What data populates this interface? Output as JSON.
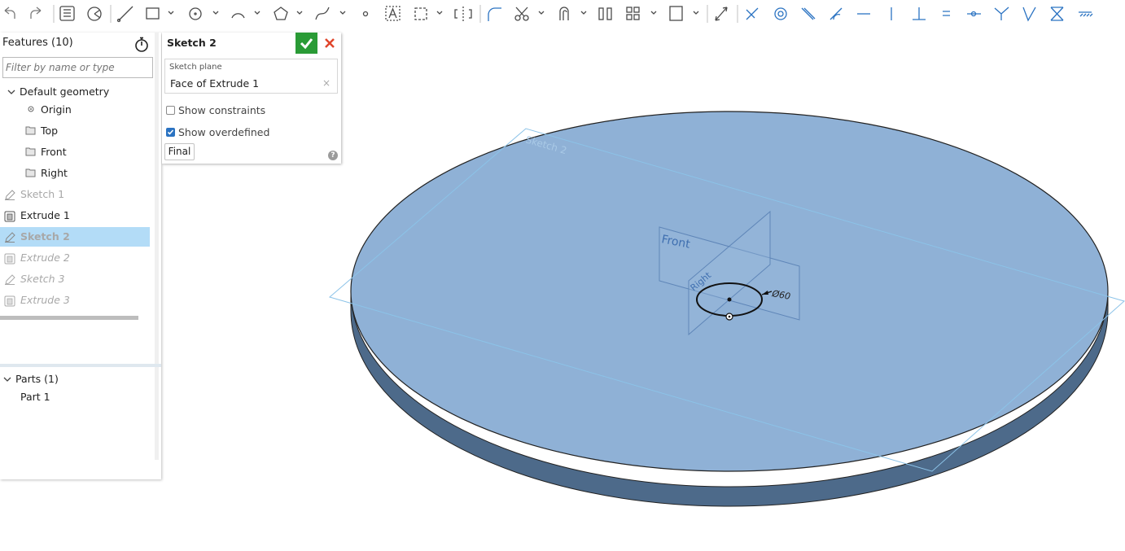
{
  "toolbar": {
    "tools": [
      "undo-icon",
      "redo-icon",
      "feature-list-icon",
      "render-mode-icon",
      "line-tool-icon",
      "rectangle-tool-icon",
      "circle-tool-icon",
      "arc-tool-icon",
      "polygon-tool-icon",
      "spline-tool-icon",
      "point-tool-icon",
      "text-tool-icon",
      "construction-tool-icon",
      "mirror-tool-icon",
      "fillet-tool-icon",
      "trim-tool-icon",
      "offset-tool-icon",
      "transform-tool-icon",
      "pattern-tool-icon",
      "dxf-import-icon",
      "dimension-tool-icon",
      "coincident-icon",
      "concentric-icon",
      "parallel-icon",
      "tangent-icon",
      "horizontal-icon",
      "vertical-icon",
      "perpendicular-icon",
      "equal-icon",
      "midpoint-icon",
      "normal-icon",
      "pierce-icon",
      "symmetric-icon",
      "fix-icon"
    ]
  },
  "feature_panel": {
    "title": "Features (10)",
    "filter_placeholder": "Filter by name or type",
    "tree": [
      {
        "label": "Default geometry"
      },
      {
        "label": "Origin"
      },
      {
        "label": "Top"
      },
      {
        "label": "Front"
      },
      {
        "label": "Right"
      },
      {
        "label": "Sketch 1"
      },
      {
        "label": "Extrude 1"
      },
      {
        "label": "Sketch 2"
      },
      {
        "label": "Extrude 2"
      },
      {
        "label": "Sketch 3"
      },
      {
        "label": "Extrude 3"
      }
    ],
    "parts_header": "Parts (1)",
    "parts": [
      {
        "label": "Part 1"
      }
    ]
  },
  "sketch_dialog": {
    "title": "Sketch 2",
    "plane_label": "Sketch plane",
    "plane_value": "Face of Extrude 1",
    "clear_glyph": "×",
    "show_constraints": "Show constraints",
    "show_overdefined": "Show overdefined",
    "final_button": "Final",
    "help_glyph": "?"
  },
  "viewport": {
    "sketch_plane_label": "Sketch 2",
    "front_plane_label": "Front",
    "right_plane_label": "Right",
    "dimension_label": "Ø60",
    "colors": {
      "disc_top": "#8fb1d6",
      "disc_side": "#4d6a8a",
      "plane_outline": "#8cc3e8",
      "accent_ok": "#2a9b36",
      "accent_cancel": "#e0452b"
    }
  }
}
